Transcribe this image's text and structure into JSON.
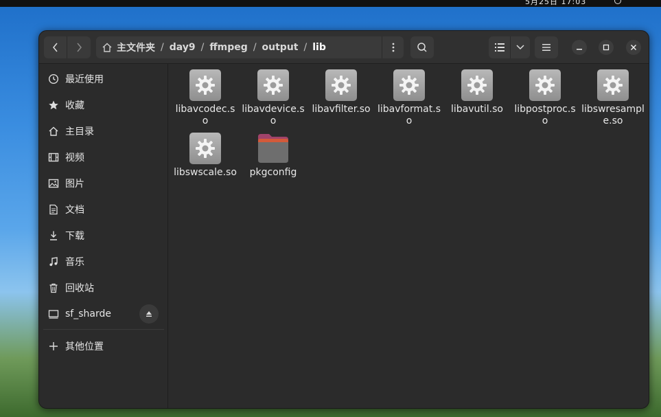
{
  "topbar": {
    "clock": "5月25日 17:03"
  },
  "window": {
    "path": [
      {
        "label": "主文件夹",
        "is_home": true
      },
      {
        "label": "day9"
      },
      {
        "label": "ffmpeg"
      },
      {
        "label": "output"
      },
      {
        "label": "lib",
        "current": true
      }
    ]
  },
  "sidebar": {
    "items": [
      {
        "label": "最近使用",
        "icon": "clock-icon"
      },
      {
        "label": "收藏",
        "icon": "star-icon"
      },
      {
        "label": "主目录",
        "icon": "home-icon"
      },
      {
        "label": "视频",
        "icon": "film-icon"
      },
      {
        "label": "图片",
        "icon": "image-icon"
      },
      {
        "label": "文档",
        "icon": "document-icon"
      },
      {
        "label": "下载",
        "icon": "download-icon"
      },
      {
        "label": "音乐",
        "icon": "music-icon"
      },
      {
        "label": "回收站",
        "icon": "trash-icon"
      },
      {
        "label": "sf_sharde",
        "icon": "drive-icon"
      }
    ],
    "other_locations": "其他位置"
  },
  "files": [
    {
      "name": "libavcodec.so",
      "type": "library"
    },
    {
      "name": "libavdevice.so",
      "type": "library"
    },
    {
      "name": "libavfilter.so",
      "type": "library"
    },
    {
      "name": "libavformat.so",
      "type": "library"
    },
    {
      "name": "libavutil.so",
      "type": "library"
    },
    {
      "name": "libpostproc.so",
      "type": "library"
    },
    {
      "name": "libswresample.so",
      "type": "library"
    },
    {
      "name": "libswscale.so",
      "type": "library"
    },
    {
      "name": "pkgconfig",
      "type": "folder"
    }
  ],
  "colors": {
    "window_bg": "#2b2b2b",
    "headerbar_bg": "#303030",
    "button_bg": "#3a3a3a",
    "folder": "#8a5a6e"
  }
}
